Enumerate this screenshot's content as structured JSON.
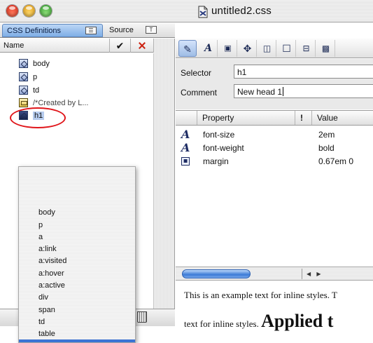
{
  "window": {
    "title": "untitled2.css",
    "doc_icon": "css-document-icon"
  },
  "tabs": {
    "css_definitions": "CSS Definitions",
    "source": "Source"
  },
  "rule_list": {
    "header": {
      "name": "Name",
      "check_icon": "checkmark-icon",
      "x_icon": "red-x-icon"
    },
    "items": [
      {
        "label": "body",
        "type": "selector"
      },
      {
        "label": "p",
        "type": "selector"
      },
      {
        "label": "td",
        "type": "selector"
      },
      {
        "label": "/*Created by L...",
        "type": "comment"
      },
      {
        "label": "h1",
        "type": "selector",
        "selected": true
      }
    ]
  },
  "popup_menu": {
    "items": [
      "body",
      "p",
      "a",
      "a:link",
      "a:visited",
      "a:hover",
      "a:active",
      "div",
      "span",
      "td",
      "table"
    ]
  },
  "toolbar": {
    "buttons": [
      "edit-pen-icon",
      "font-icon",
      "background-icon",
      "position-icon",
      "box-icon",
      "border-icon",
      "list-icon",
      "pattern-icon"
    ]
  },
  "form": {
    "selector_label": "Selector",
    "selector_value": "h1",
    "comment_label": "Comment",
    "comment_value": "New head 1"
  },
  "properties": {
    "headers": {
      "property": "Property",
      "flag": "!",
      "value": "Value"
    },
    "rows": [
      {
        "icon": "font-icon",
        "name": "font-size",
        "value": "2em"
      },
      {
        "icon": "font-icon",
        "name": "font-weight",
        "value": "bold"
      },
      {
        "icon": "box-icon",
        "name": "margin",
        "value": "0.67em 0"
      }
    ]
  },
  "preview": {
    "line1": "This is an example text for inline styles. T",
    "line2_small": "text for inline styles. ",
    "line2_big": "Applied t"
  },
  "colors": {
    "selection_blue": "#b5cbee",
    "annotation_red": "#e0151a",
    "scroll_thumb": "#3b7ad6"
  }
}
